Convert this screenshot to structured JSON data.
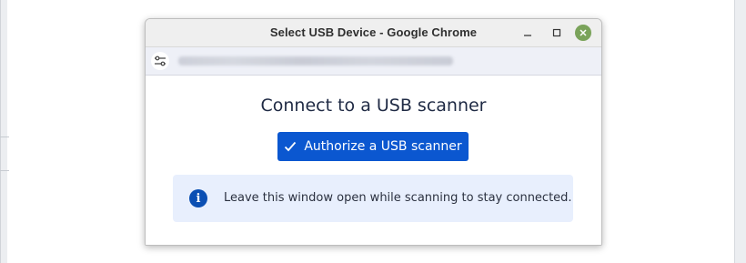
{
  "window": {
    "title": "Select USB Device - Google Chrome"
  },
  "addressbar": {
    "url_blurred": true,
    "settings_icon": "tune-icon"
  },
  "dialog": {
    "heading": "Connect to a USB scanner",
    "authorize_button": "Authorize a USB scanner",
    "authorize_icon": "check-icon",
    "info_icon": "info-icon",
    "info_text": "Leave this window open while scanning to stay connected."
  },
  "colors": {
    "primary_button": "#0b57d0",
    "info_background": "#e8effd",
    "close_button": "#7aa35a"
  }
}
